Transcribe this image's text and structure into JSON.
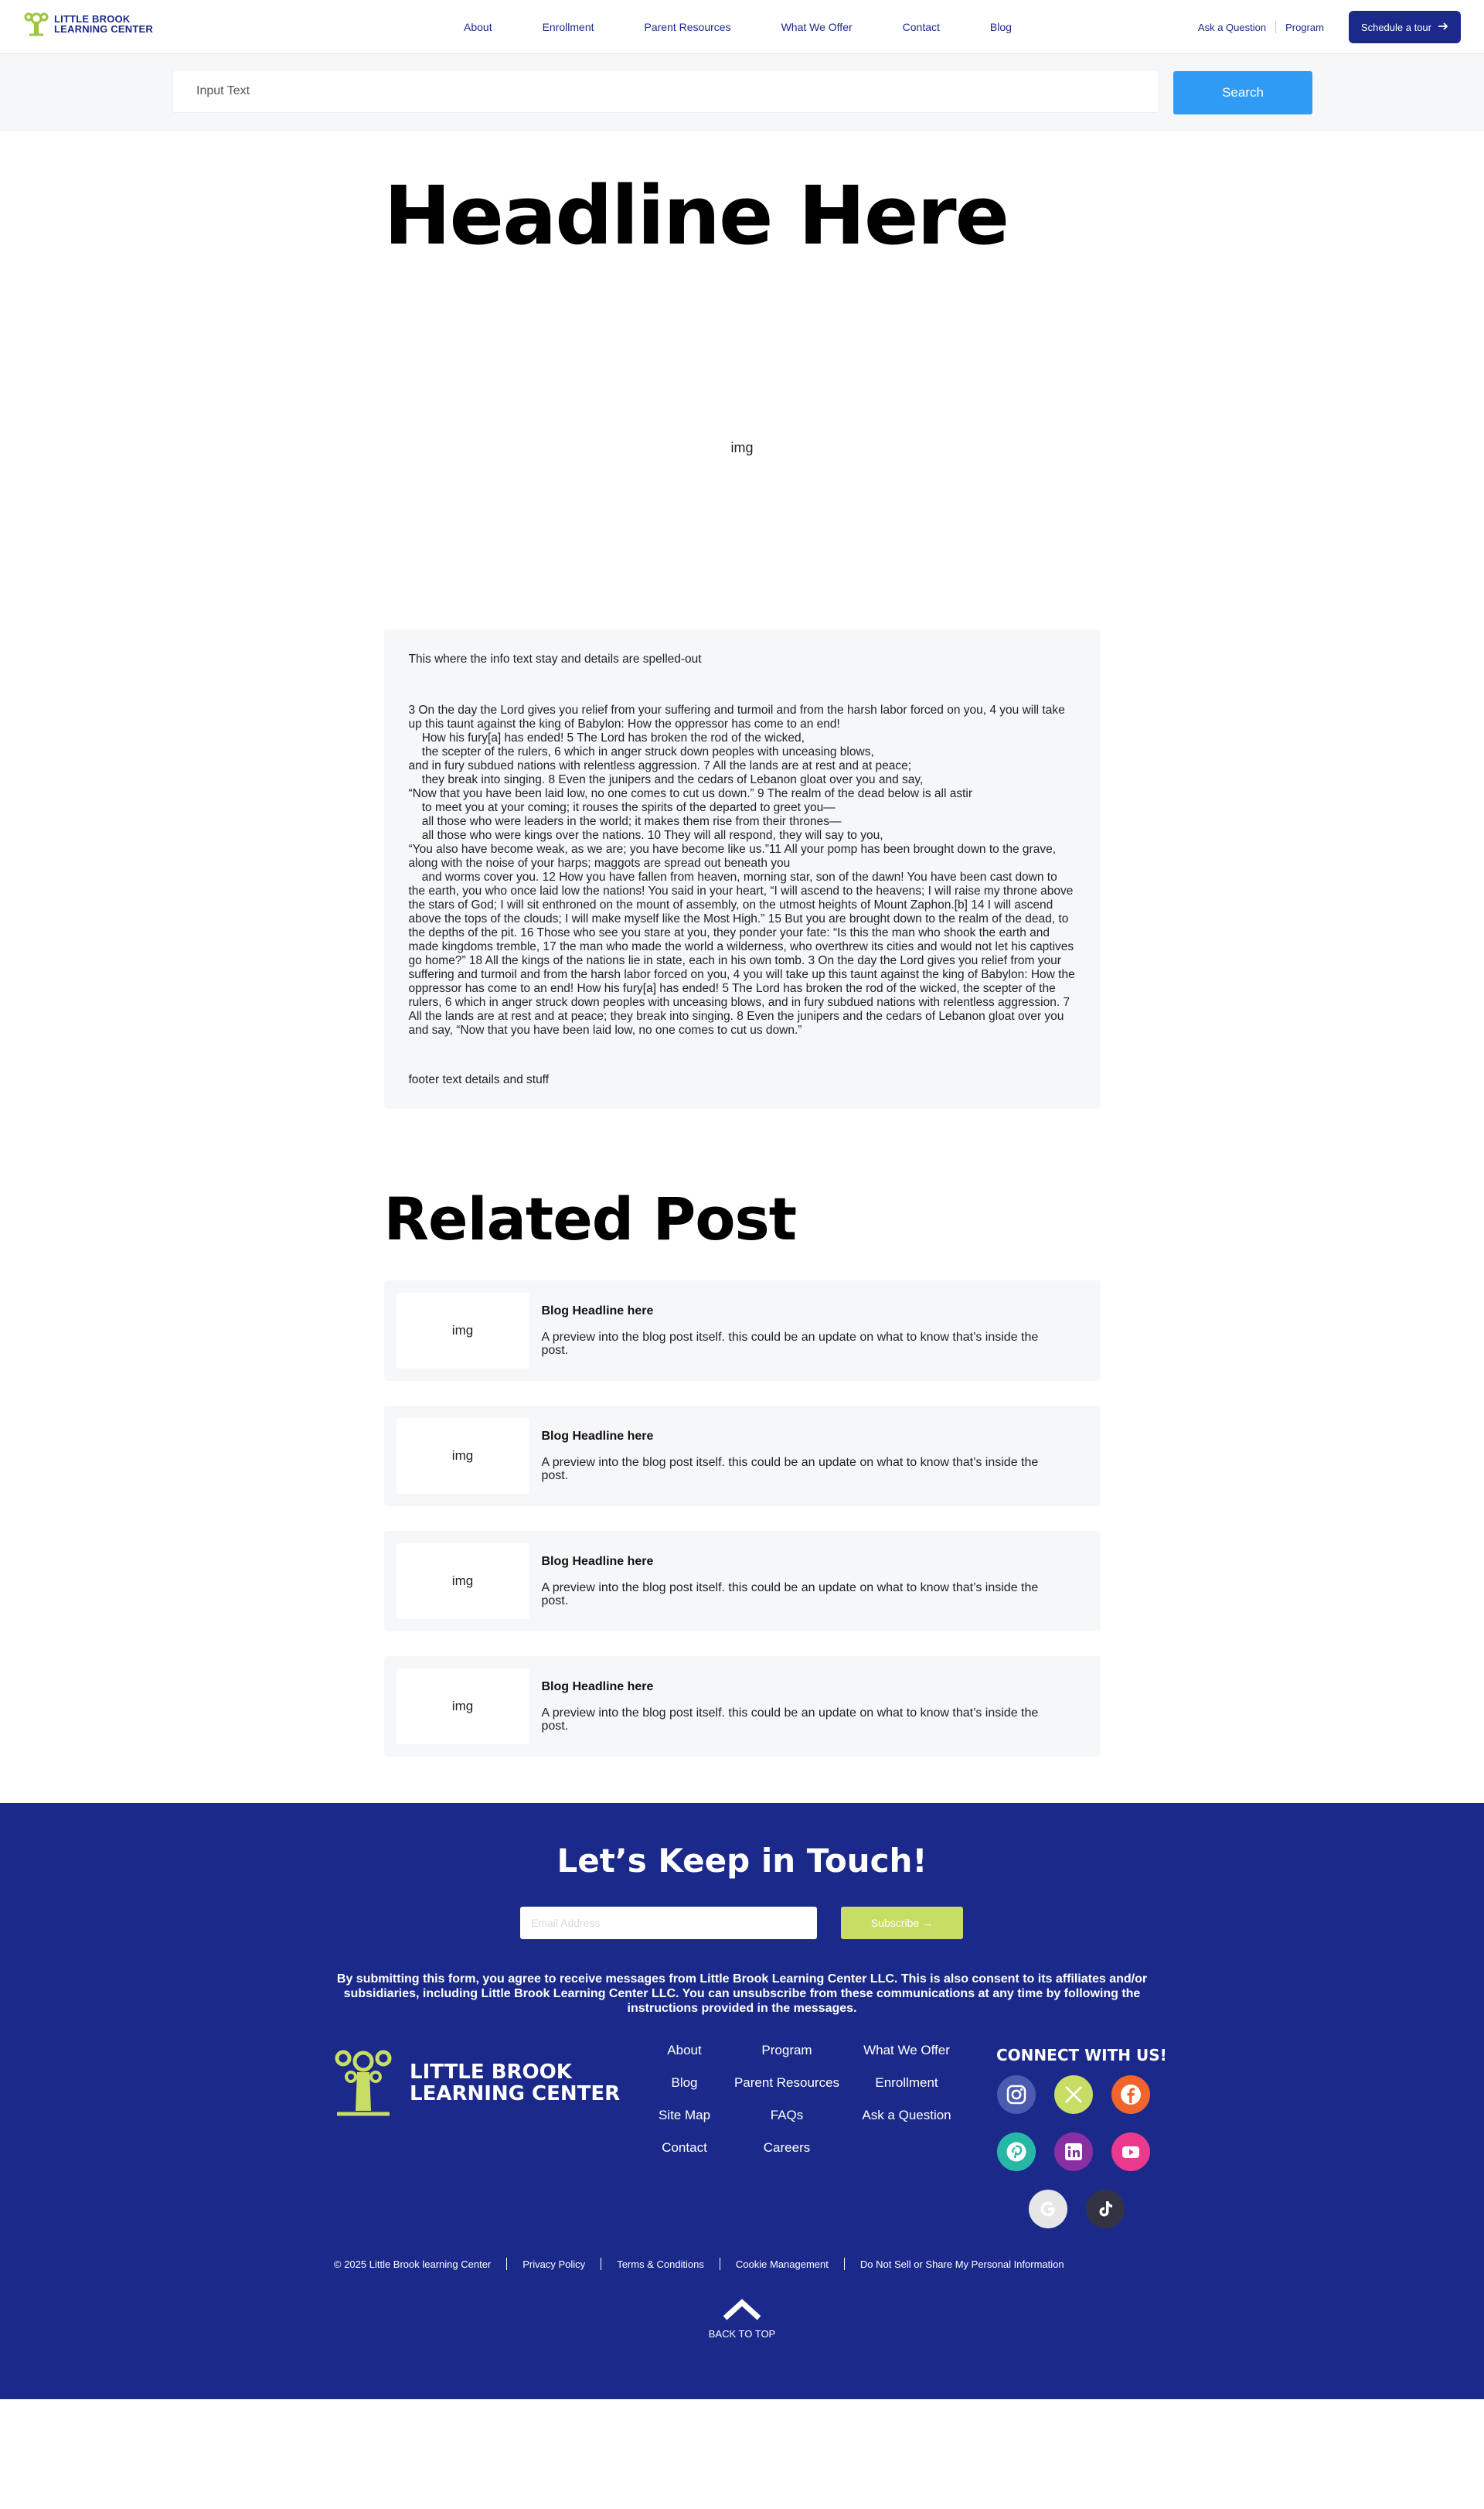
{
  "header": {
    "logo_line1": "LITTLE BROOK",
    "logo_line2": "LEARNING CENTER",
    "nav": [
      "About",
      "Enrollment",
      "Parent Resources",
      "What We Offer",
      "Contact",
      "Blog"
    ],
    "ask": "Ask a Question",
    "program": "Program",
    "tour": "Schedule a tour"
  },
  "search": {
    "placeholder": "Input Text",
    "button": "Search"
  },
  "article": {
    "headline": "Headline Here",
    "hero_img": "img",
    "intro": "This where the info text stay and details are spelled-out",
    "body": "3 On the day the Lord gives you relief from your suffering and turmoil and from the harsh labor forced on you, 4 you will take up this taunt against the king of Babylon: How the oppressor has come to an end!\n    How his fury[a] has ended! 5 The Lord has broken the rod of the wicked,\n    the scepter of the rulers, 6 which in anger struck down peoples with unceasing blows,\nand in fury subdued nations with relentless aggression. 7 All the lands are at rest and at peace;\n    they break into singing. 8 Even the junipers and the cedars of Lebanon gloat over you and say,\n“Now that you have been laid low, no one comes to cut us down.” 9 The realm of the dead below is all astir\n    to meet you at your coming; it rouses the spirits of the departed to greet you—\n    all those who were leaders in the world; it makes them rise from their thrones—\n    all those who were kings over the nations. 10 They will all respond, they will say to you,\n“You also have become weak, as we are; you have become like us.”11 All your pomp has been brought down to the grave, along with the noise of your harps; maggots are spread out beneath you\n    and worms cover you. 12 How you have fallen from heaven, morning star, son of the dawn! You have been cast down to the earth, you who once laid low the nations! You said in your heart, “I will ascend to the heavens; I will raise my throne above the stars of God; I will sit enthroned on the mount of assembly, on the utmost heights of Mount Zaphon.[b] 14 I will ascend above the tops of the clouds; I will make myself like the Most High.” 15 But you are brought down to the realm of the dead, to the depths of the pit. 16 Those who see you stare at you, they ponder your fate: “Is this the man who shook the earth and made kingdoms tremble, 17 the man who made the world a wilderness, who overthrew its cities and would not let his captives go home?” 18 All the kings of the nations lie in state, each in his own tomb. 3 On the day the Lord gives you relief from your suffering and turmoil and from the harsh labor forced on you, 4 you will take up this taunt against the king of Babylon: How the oppressor has come to an end! How his fury[a] has ended! 5 The Lord has broken the rod of the wicked, the scepter of the rulers, 6 which in anger struck down peoples with unceasing blows, and in fury subdued nations with relentless aggression. 7 All the lands are at rest and at peace; they break into singing. 8 Even the junipers and the cedars of Lebanon gloat over you and say, “Now that you have been laid low, no one comes to cut us down.”",
    "footer": "footer text details and stuff"
  },
  "related": {
    "title": "Related Post",
    "posts": [
      {
        "img": "img",
        "title": "Blog Headline here",
        "desc": "A preview into the blog post itself. this could be an update on what to know that’s inside the post."
      },
      {
        "img": "img",
        "title": "Blog Headline here",
        "desc": "A preview into the blog post itself. this could be an update on what to know that’s inside the post."
      },
      {
        "img": "img",
        "title": "Blog Headline here",
        "desc": "A preview into the blog post itself. this could be an update on what to know that’s inside the post."
      },
      {
        "img": "img",
        "title": "Blog Headline here",
        "desc": "A preview into the blog post itself. this could be an update on what to know that’s inside the post."
      }
    ]
  },
  "footer": {
    "keep_title": "Let’s Keep in Touch!",
    "email_placeholder": "Email Address",
    "subscribe": "Subscribe",
    "consent": "By submitting this form, you agree to receive messages from Little Brook Learning Center LLC. This is also consent to its affiliates and/or subsidiaries, including Little Brook Learning Center LLC. You can unsubscribe from these communications at any time by following the instructions provided in the messages.",
    "logo_line1": "LITTLE BROOK",
    "logo_line2": "LEARNING CENTER",
    "links": [
      "About",
      "Program",
      "What We Offer",
      "Blog",
      "Parent Resources",
      "Enrollment",
      "Site Map",
      "FAQs",
      "Ask a Question",
      "Contact",
      "Careers"
    ],
    "connect": "CONNECT WITH US!",
    "socials": [
      {
        "name": "instagram-icon",
        "color": "#4a5bb0"
      },
      {
        "name": "x-icon",
        "color": "#c8dd63"
      },
      {
        "name": "facebook-icon",
        "color": "#f0642d"
      },
      {
        "name": "pinterest-icon",
        "color": "#27b7a6"
      },
      {
        "name": "linkedin-icon",
        "color": "#8a2fa3"
      },
      {
        "name": "youtube-icon",
        "color": "#ea3a8e"
      },
      {
        "name": "google-icon",
        "color": "#e6e6e6"
      },
      {
        "name": "tiktok-icon",
        "color": "#333344"
      }
    ],
    "copyright": "© 2025 Little Brook learning Center",
    "privacy": "Privacy Policy",
    "terms": "Terms & Conditions",
    "cookie": "Cookie Management",
    "do_not_sell": "Do Not Sell or Share My Personal Information",
    "back_to_top": "BACK TO TOP"
  },
  "colors": {
    "brand_navy": "#1b2a8a",
    "search_blue": "#2f9bf5",
    "lime": "#c8dd63",
    "card_bg": "#f6f7f9"
  }
}
